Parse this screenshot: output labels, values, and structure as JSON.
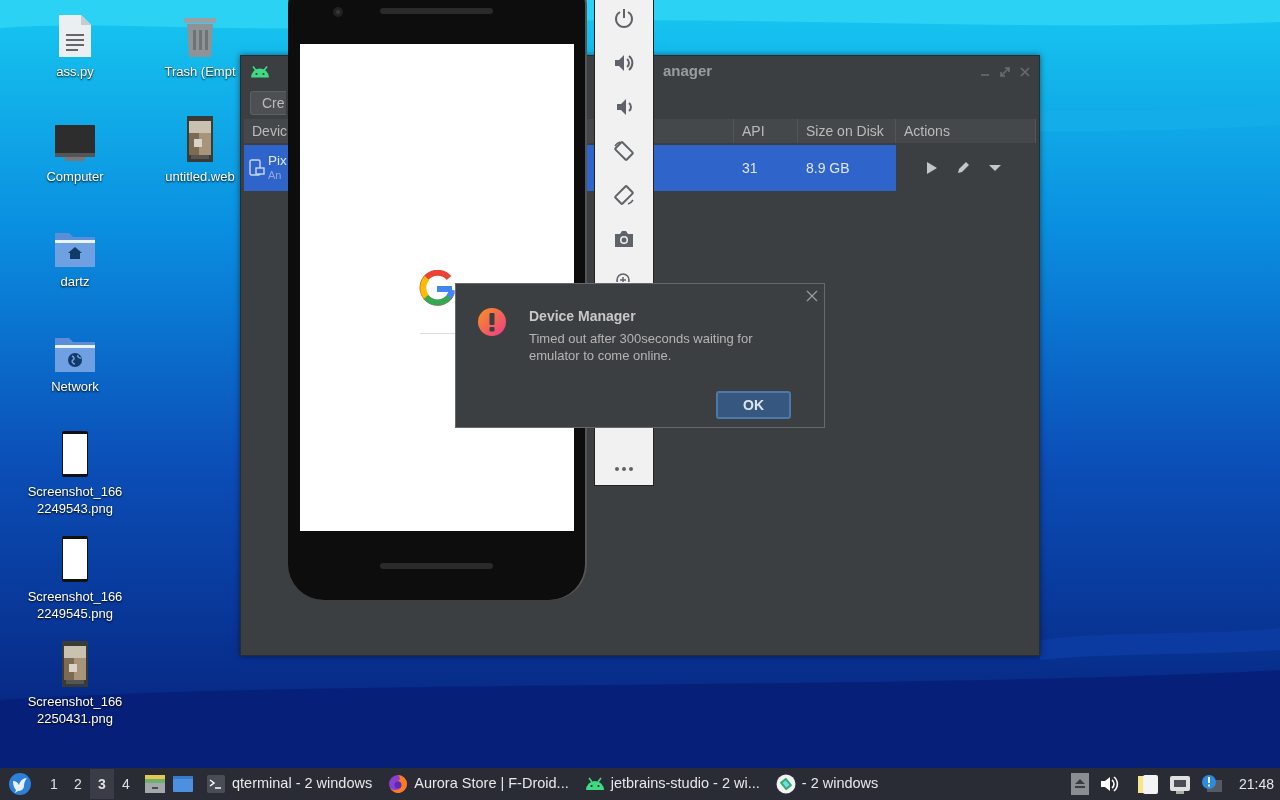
{
  "desktop_icons": [
    {
      "label": "ass.py",
      "kind": "document"
    },
    {
      "label": "Computer",
      "kind": "monitor"
    },
    {
      "label": "dartz",
      "kind": "home-folder"
    },
    {
      "label": "Network",
      "kind": "network-folder"
    },
    {
      "label": "Screenshot_1662249543.png",
      "kind": "phone-shot"
    },
    {
      "label": "Screenshot_1662249545.png",
      "kind": "phone-shot"
    },
    {
      "label": "Screenshot_1662250431.png"
    },
    {
      "label": "Trash (Empt",
      "kind": "trash"
    },
    {
      "label": "untitled.web"
    }
  ],
  "device_manager": {
    "title": "anager",
    "toolbar_button": "Cre",
    "columns": [
      "Devic",
      "API",
      "Size on Disk",
      "Actions"
    ],
    "rows": [
      {
        "name": "Pix",
        "subtitle": "An",
        "api": "31",
        "size": "8.9 GB",
        "selected": true
      }
    ]
  },
  "dialog": {
    "title": "Device Manager",
    "message": "Timed out after 300seconds waiting for emulator to come online.",
    "button": "OK"
  },
  "taskbar": {
    "workspaces": [
      {
        "label": "1",
        "selected": false
      },
      {
        "label": "2",
        "selected": false
      },
      {
        "label": "3",
        "selected": true
      },
      {
        "label": "4",
        "selected": false
      }
    ],
    "tasks": [
      {
        "label": "qterminal - 2 windows",
        "kind": "terminal"
      },
      {
        "label": "Aurora Store | F-Droid...",
        "kind": "browser"
      },
      {
        "label": "jetbrains-studio - 2 wi...",
        "kind": "robot"
      },
      {
        "label": "- 2 windows",
        "kind": "app"
      }
    ],
    "clock": "21:48"
  }
}
